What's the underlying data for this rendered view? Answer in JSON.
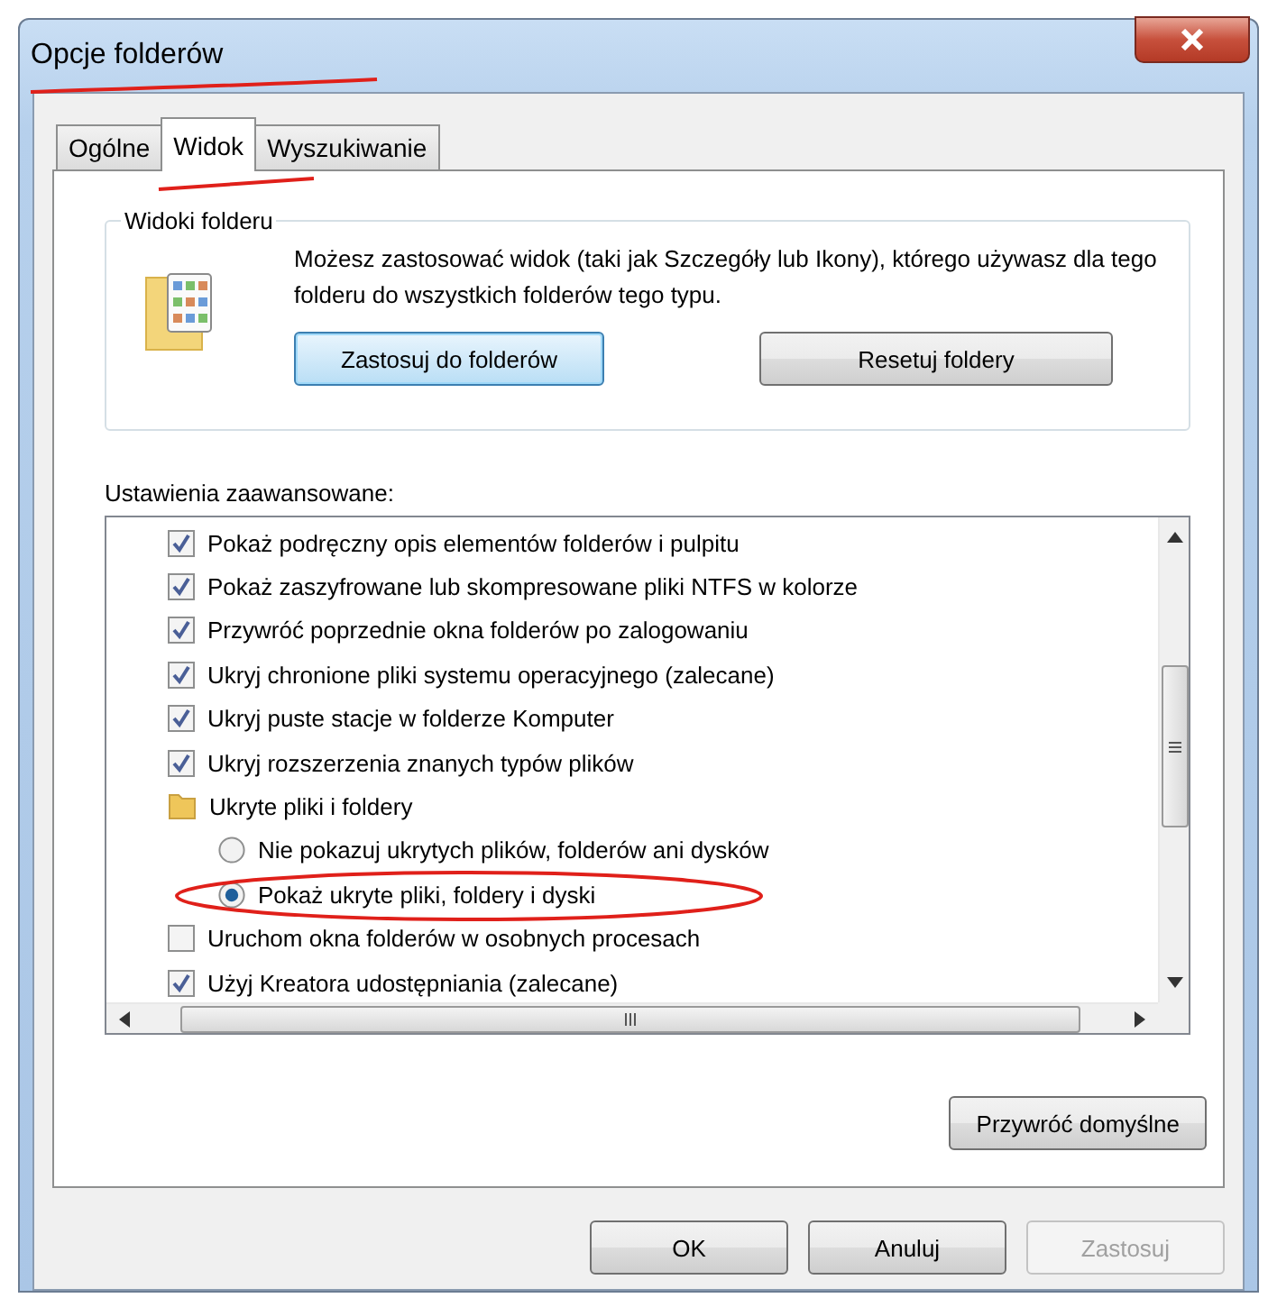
{
  "window": {
    "title": "Opcje folderów"
  },
  "tabs": [
    {
      "label": "Ogólne",
      "selected": false
    },
    {
      "label": "Widok",
      "selected": true
    },
    {
      "label": "Wyszukiwanie",
      "selected": false
    }
  ],
  "folder_views": {
    "title": "Widoki folderu",
    "description": "Możesz zastosować widok (taki jak Szczegóły lub Ikony), którego używasz dla tego folderu do wszystkich folderów tego typu.",
    "buttons": [
      {
        "label": "Zastosuj do folderów",
        "focused": true
      },
      {
        "label": "Resetuj foldery",
        "focused": false
      }
    ]
  },
  "advanced": {
    "label": "Ustawienia zaawansowane:",
    "items": [
      {
        "kind": "checkbox",
        "label": "Pokaż podręczny opis elementów folderów i pulpitu",
        "checked": true
      },
      {
        "kind": "checkbox",
        "label": "Pokaż zaszyfrowane lub skompresowane pliki NTFS w kolorze",
        "checked": true
      },
      {
        "kind": "checkbox",
        "label": "Przywróć poprzednie okna folderów po zalogowaniu",
        "checked": true
      },
      {
        "kind": "checkbox",
        "label": "Ukryj chronione pliki systemu operacyjnego (zalecane)",
        "checked": true
      },
      {
        "kind": "checkbox",
        "label": "Ukryj puste stacje w folderze Komputer",
        "checked": true
      },
      {
        "kind": "checkbox",
        "label": "Ukryj rozszerzenia znanych typów plików",
        "checked": true
      },
      {
        "kind": "folder",
        "label": "Ukryte pliki i foldery",
        "children": [
          {
            "kind": "radio",
            "label": "Nie pokazuj ukrytych plików, folderów ani dysków",
            "selected": false
          },
          {
            "kind": "radio",
            "label": "Pokaż ukryte pliki, foldery i dyski",
            "selected": true
          }
        ]
      },
      {
        "kind": "checkbox",
        "label": "Uruchom okna folderów w osobnych procesach",
        "checked": false
      },
      {
        "kind": "checkbox",
        "label": "Użyj Kreatora udostępniania (zalecane)",
        "checked": true
      }
    ],
    "restore_button": "Przywróć domyślne"
  },
  "buttons": [
    {
      "label": "OK",
      "disabled": false
    },
    {
      "label": "Anuluj",
      "disabled": false
    },
    {
      "label": "Zastosuj",
      "disabled": true
    }
  ]
}
